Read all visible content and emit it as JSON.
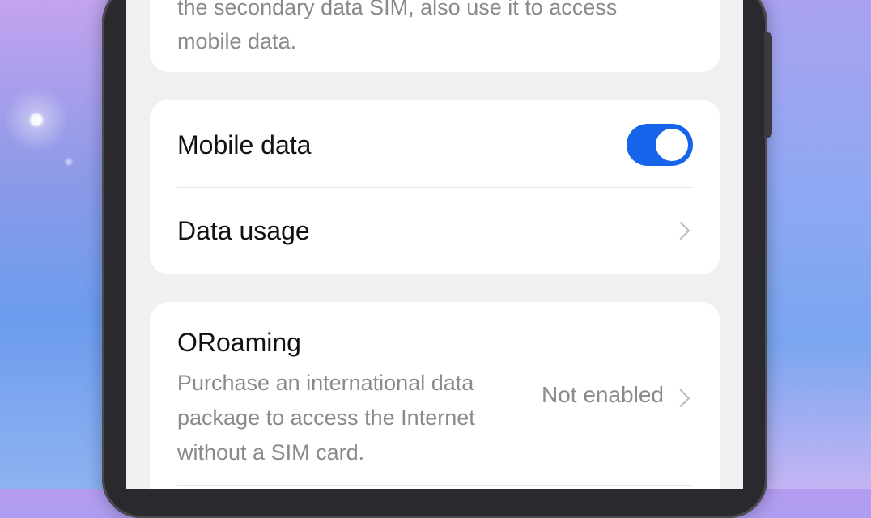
{
  "top_card": {
    "description": "the secondary data SIM, also use it to access mobile data."
  },
  "mobile_data": {
    "label": "Mobile data",
    "enabled": true
  },
  "data_usage": {
    "label": "Data usage"
  },
  "oroaming": {
    "title": "ORoaming",
    "description": "Purchase an international data package to access the Internet without a SIM card.",
    "status": "Not enabled"
  },
  "colors": {
    "accent": "#1664ea",
    "background": "#f0f0f2",
    "card": "#ffffff",
    "secondary_text": "#8a8a8e"
  }
}
